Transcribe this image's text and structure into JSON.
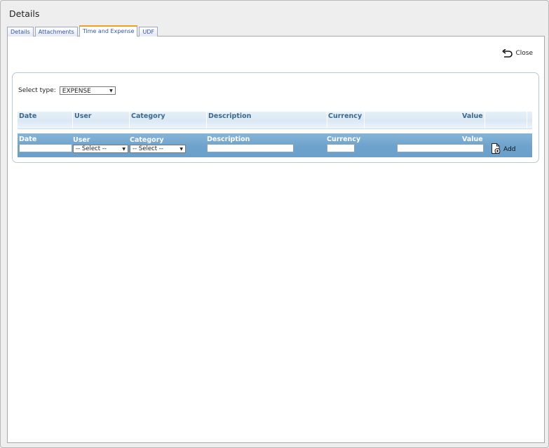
{
  "window": {
    "title": "Details"
  },
  "tabs": [
    {
      "label": "Details",
      "active": false
    },
    {
      "label": "Attachments",
      "active": false
    },
    {
      "label": "Time and Expense",
      "active": true
    },
    {
      "label": "UDF",
      "active": false
    }
  ],
  "toolbar": {
    "close_label": "Close",
    "close_icon": "undo-arrow-icon"
  },
  "type_selector": {
    "label": "Select type:",
    "value": "EXPENSE"
  },
  "table": {
    "columns": [
      "Date",
      "User",
      "Category",
      "Description",
      "Currency",
      "Value"
    ],
    "rows": []
  },
  "add_row": {
    "labels": [
      "Date",
      "User",
      "Category",
      "Description",
      "Currency",
      "Value"
    ],
    "user_select": "-- Select --",
    "category_select": "-- Select --",
    "add_label": "Add",
    "add_icon": "add-document-icon"
  },
  "colors": {
    "header_text": "#3a6890",
    "add_row_bg": "#6ea2cc",
    "active_tab_accent": "#f0a020",
    "tab_text": "#3355aa"
  }
}
